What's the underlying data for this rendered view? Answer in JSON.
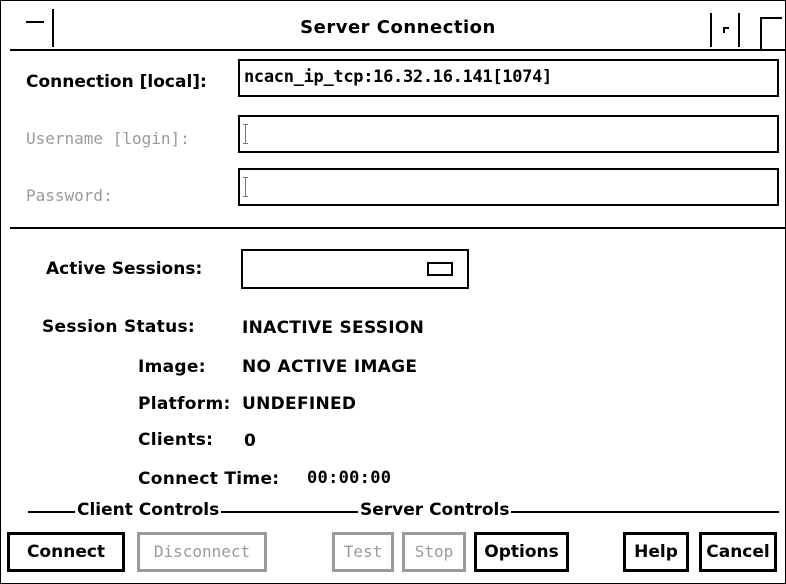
{
  "window": {
    "title": "Server Connection"
  },
  "form": {
    "connection_label": "Connection [local]:",
    "connection_value": "ncacn_ip_tcp:16.32.16.141[1074]",
    "username_label": "Username  [login]:",
    "username_value": "",
    "password_label": "Password:",
    "password_value": ""
  },
  "sessions": {
    "active_label": "Active Sessions:",
    "active_value": ""
  },
  "status": {
    "session_status_label": "Session Status:",
    "session_status_value": "INACTIVE SESSION",
    "image_label": "Image:",
    "image_value": "NO ACTIVE IMAGE",
    "platform_label": "Platform:",
    "platform_value": "UNDEFINED",
    "clients_label": "Clients:",
    "clients_value": "0",
    "connect_time_label": "Connect Time:",
    "connect_time_value": "00:00:00"
  },
  "groups": {
    "client_controls": "Client Controls",
    "server_controls": "Server Controls"
  },
  "buttons": {
    "connect": "Connect",
    "disconnect": "Disconnect",
    "test": "Test",
    "stop": "Stop",
    "options": "Options",
    "help": "Help",
    "cancel": "Cancel"
  },
  "icons": {
    "window_menu": "window-menu-icon",
    "minimize": "minimize-icon",
    "maximize": "maximize-icon",
    "option_indicator": "option-menu-indicator-icon"
  },
  "colors": {
    "foreground": "#000000",
    "background": "#ffffff",
    "disabled": "#9a9a9a"
  }
}
